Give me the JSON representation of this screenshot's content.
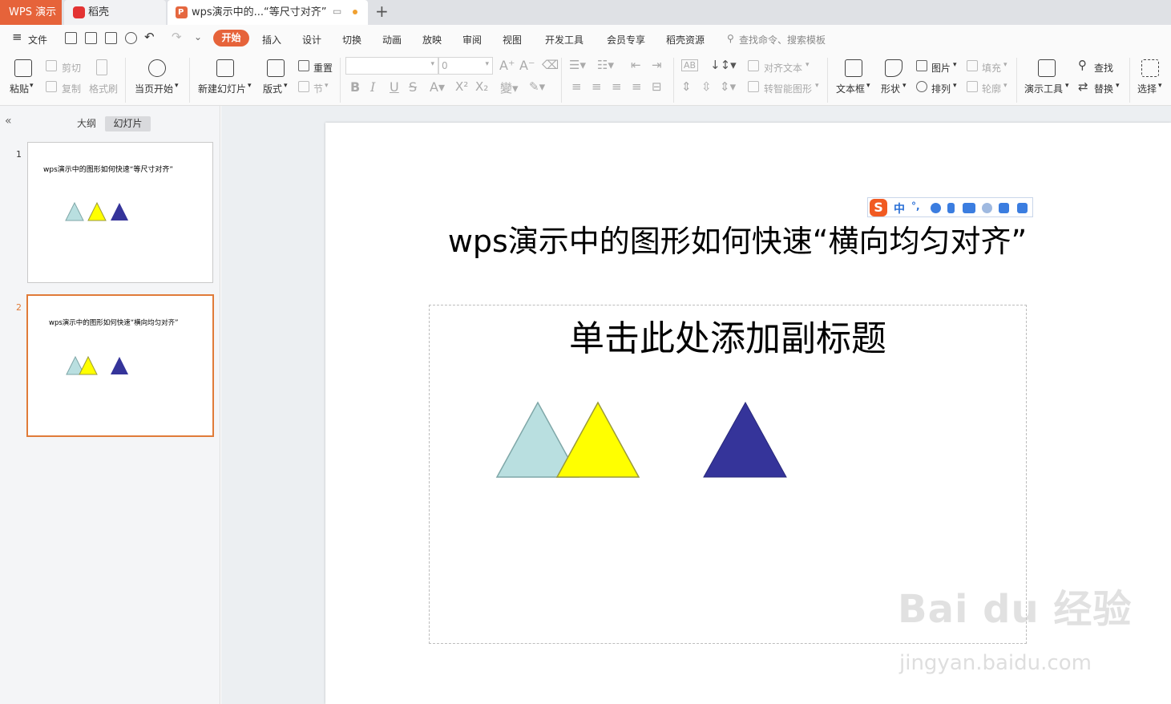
{
  "tabs": {
    "app": "WPS 演示",
    "daoke": "稻壳",
    "document": "wps演示中的...“等尺寸对齐”",
    "add_icon": "plus-icon"
  },
  "menu": {
    "file": "文件",
    "items": [
      "开始",
      "插入",
      "设计",
      "切换",
      "动画",
      "放映",
      "审阅",
      "视图",
      "开发工具",
      "会员专享",
      "稻壳资源"
    ],
    "search": "查找命令、搜索模板"
  },
  "ribbon": {
    "paste": "粘贴",
    "cut": "剪切",
    "copy": "复制",
    "format_painter": "格式刷",
    "play_from_current": "当页开始",
    "new_slide": "新建幻灯片",
    "layout": "版式",
    "reset": "重置",
    "section": "节",
    "font_size": "0",
    "align_text": "对齐文本",
    "smartart": "转智能图形",
    "textbox": "文本框",
    "shape": "形状",
    "picture": "图片",
    "arrange": "排列",
    "fill": "填充",
    "outline": "轮廓",
    "present_tools": "演示工具",
    "find": "查找",
    "replace": "替换",
    "select": "选择"
  },
  "panel": {
    "outline_tab": "大纲",
    "slides_tab": "幻灯片",
    "slides": [
      {
        "num": "1",
        "title": "wps演示中的图形如何快速“等尺寸对齐”"
      },
      {
        "num": "2",
        "title": "wps演示中的图形如何快速“横向均匀对齐”"
      }
    ],
    "selected": 2
  },
  "slide": {
    "title": "wps演示中的图形如何快速“横向均匀对齐”",
    "subtitle_placeholder": "单击此处添加副标题",
    "shapes": [
      {
        "type": "triangle",
        "fill": "#b9dfe0",
        "stroke": "#7fa7a8"
      },
      {
        "type": "triangle",
        "fill": "#ffff00",
        "stroke": "#9a9a3a"
      },
      {
        "type": "triangle",
        "fill": "#35349a",
        "stroke": "#28287a"
      }
    ]
  },
  "ime": {
    "brand": "S",
    "mode": "中",
    "punct": "°,"
  },
  "watermark": {
    "main": "Bai du 经验",
    "url": "jingyan.baidu.com"
  },
  "colors": {
    "accent": "#e6633a",
    "selected_border": "#e07b39"
  }
}
